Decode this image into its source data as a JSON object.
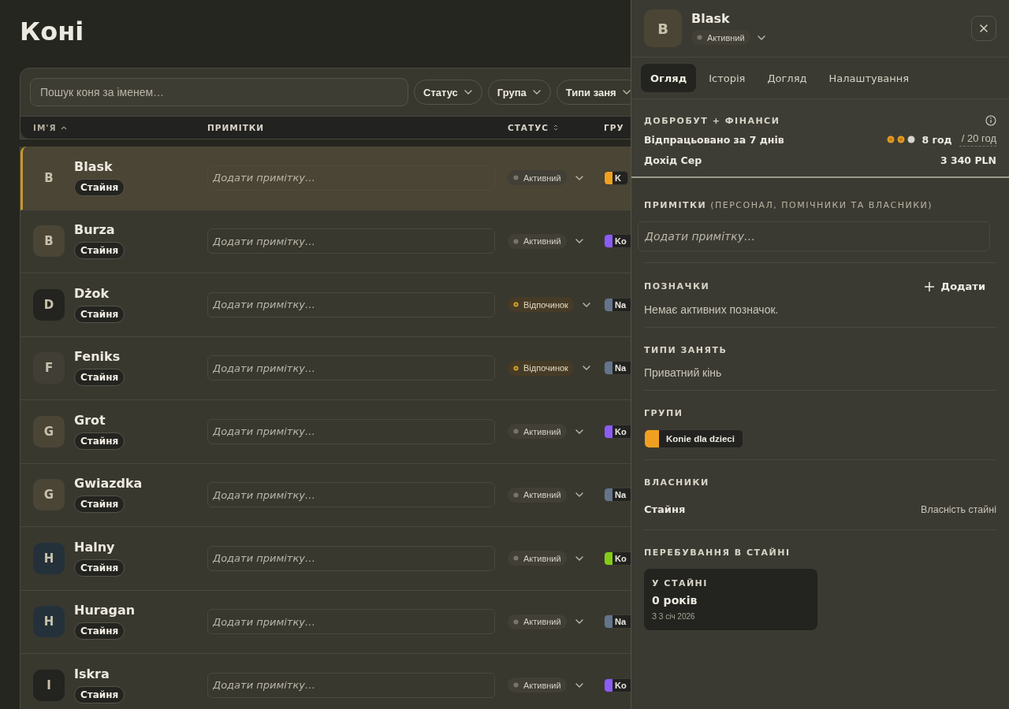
{
  "page_title": "Коні",
  "toolbar": {
    "search": {
      "placeholder": "Пошук коня за іменем…"
    },
    "filters": [
      "Статус",
      "Група",
      "Типи заня"
    ]
  },
  "table": {
    "columns": [
      {
        "label": "ІМ'Я",
        "sorted_ascending": true,
        "sortable": false
      },
      {
        "label": "ПРИМІТКИ",
        "sorted_ascending": false,
        "sortable": false
      },
      {
        "label": "СТАТУС",
        "sorted_ascending": false,
        "sortable": true
      },
      {
        "label": "ГРУ",
        "sorted_ascending": false,
        "sortable": false
      }
    ],
    "rows": [
      {
        "initial": "B",
        "color": "#4a4534",
        "name": "Blask",
        "tag": "Стайня",
        "note_placeholder": "Додати примітку…",
        "status": {
          "label": "Активний",
          "kind": "active"
        },
        "group": {
          "label": "K",
          "color": "#f0a020"
        },
        "selected": true
      },
      {
        "initial": "B",
        "color": "#4a4535",
        "name": "Burza",
        "tag": "Стайня",
        "note_placeholder": "Додати примітку…",
        "status": {
          "label": "Активний",
          "kind": "active"
        },
        "group": {
          "label": "Ko",
          "color": "#8b5cf6"
        },
        "selected": false
      },
      {
        "initial": "D",
        "color": "#23231f",
        "name": "Dżok",
        "tag": "Стайня",
        "note_placeholder": "Додати примітку…",
        "status": {
          "label": "Відпочинок",
          "kind": "rest"
        },
        "group": {
          "label": "Na",
          "color": "#64748b"
        },
        "selected": false
      },
      {
        "initial": "F",
        "color": "#403e35",
        "name": "Feniks",
        "tag": "Стайня",
        "note_placeholder": "Додати примітку…",
        "status": {
          "label": "Відпочинок",
          "kind": "rest"
        },
        "group": {
          "label": "Na",
          "color": "#64748b"
        },
        "selected": false
      },
      {
        "initial": "G",
        "color": "#4a4535",
        "name": "Grot",
        "tag": "Стайня",
        "note_placeholder": "Додати примітку…",
        "status": {
          "label": "Активний",
          "kind": "active"
        },
        "group": {
          "label": "Ko",
          "color": "#8b5cf6"
        },
        "selected": false
      },
      {
        "initial": "G",
        "color": "#4a4535",
        "name": "Gwiazdka",
        "tag": "Стайня",
        "note_placeholder": "Додати примітку…",
        "status": {
          "label": "Активний",
          "kind": "active"
        },
        "group": {
          "label": "Na",
          "color": "#64748b"
        },
        "selected": false
      },
      {
        "initial": "H",
        "color": "#25313a",
        "name": "Halny",
        "tag": "Стайня",
        "note_placeholder": "Додати примітку…",
        "status": {
          "label": "Активний",
          "kind": "active"
        },
        "group": {
          "label": "Ko",
          "color": "#84cc16"
        },
        "selected": false
      },
      {
        "initial": "H",
        "color": "#25313a",
        "name": "Huragan",
        "tag": "Стайня",
        "note_placeholder": "Додати примітку…",
        "status": {
          "label": "Активний",
          "kind": "active"
        },
        "group": {
          "label": "Na",
          "color": "#64748b"
        },
        "selected": false
      },
      {
        "initial": "I",
        "color": "#23231f",
        "name": "Iskra",
        "tag": "Стайня",
        "note_placeholder": "Додати примітку…",
        "status": {
          "label": "Активний",
          "kind": "active"
        },
        "group": {
          "label": "Ko",
          "color": "#8b5cf6"
        },
        "selected": false
      }
    ]
  },
  "panel": {
    "initial": "B",
    "name": "Blask",
    "status": {
      "label": "Активний",
      "kind": "active"
    },
    "tabs": [
      {
        "label": "Огляд",
        "selected": true
      },
      {
        "label": "Історія",
        "selected": false
      },
      {
        "label": "Догляд",
        "selected": false
      },
      {
        "label": "Налаштування",
        "selected": false
      }
    ],
    "wellbeing": {
      "title": "ДОБРОБУТ + ФІНАНСИ",
      "worked_label": "Відпрацьовано за 7 днів",
      "dots": [
        {
          "filled": true
        },
        {
          "filled": true
        },
        {
          "filled": false
        }
      ],
      "worked_value": "8 год",
      "worked_limit": "/ 20 год",
      "income_label": "Дохід Сер",
      "income_value": "3 340 PLN"
    },
    "notes": {
      "title": "**ПРИМІТКИ** (ПЕРСОНАЛ, ПОМІЧНИКИ ТА ВЛАСНИКИ)",
      "placeholder": "Додати примітку…"
    },
    "flags": {
      "title": "ПОЗНАЧКИ",
      "add_label": "Додати",
      "empty": "Немає активних позначок."
    },
    "activity_types": {
      "title": "ТИПИ ЗАНЯТЬ",
      "value": "Приватний кінь"
    },
    "groups": {
      "title": "ГРУПИ",
      "items": [
        {
          "label": "Konie dla dzieci",
          "color": "#f0a020"
        }
      ]
    },
    "owners": {
      "title": "ВЛАСНИКИ",
      "items": [
        {
          "name": "Стайня",
          "note": "Власність стайні"
        }
      ]
    },
    "stay": {
      "title": "ПЕРЕБУВАННЯ В СТАЙНІ",
      "card_label": "У СТАЙНІ",
      "card_value": "0 років",
      "card_since": "З 3 січ 2026"
    }
  }
}
